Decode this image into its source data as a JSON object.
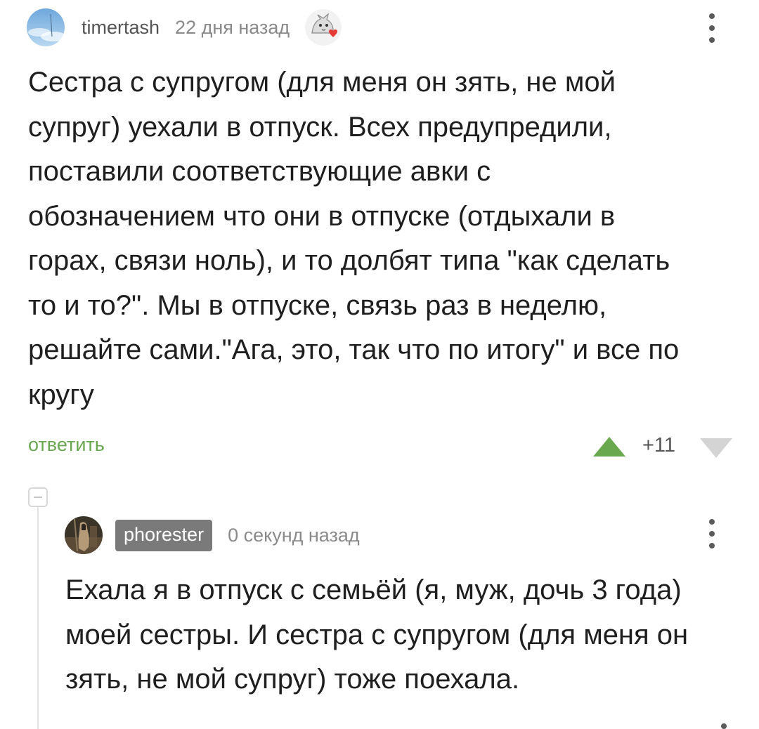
{
  "comment_1": {
    "username": "timertash",
    "timestamp": "22 дня назад",
    "avatar_icon": "avatar-sky-icon",
    "badge_icon": "cat-with-heart-icon",
    "body": "Сестра с супругом (для меня он зять, не мой\nсупруг) уехали в отпуск. Всех предупредили,\nпоставили соответствующие авки с\nобозначением что они в отпуске (отдыхали в\nгорах, связи ноль), и то долбят типа \"как сделать\nто и то?\". Мы в отпуске, связь раз в неделю,\nрешайте сами.\"Ага, это, так что по итогу\" и все по\nкругу",
    "reply_label": "ответить",
    "rating": "+11",
    "colors": {
      "reply_link": "#6aa84f",
      "vote_up": "#6aa84f",
      "vote_down": "#d4d4d4"
    }
  },
  "comment_2": {
    "username": "phorester",
    "timestamp": "0 секунд назад",
    "avatar_icon": "avatar-photo-icon",
    "body": "Ехала я в отпуск с семьёй (я, муж, дочь 3 года)\nмоей сестры. И сестра с супругом (для меня он\nзять, не мой супруг) тоже поехала.",
    "colors": {
      "username_tag_bg": "#7a7a7a"
    }
  },
  "icons": {
    "more": "more-vertical-icon",
    "collapse": "collapse-minus-icon",
    "vote_up": "triangle-up-icon",
    "vote_down": "triangle-down-icon"
  }
}
